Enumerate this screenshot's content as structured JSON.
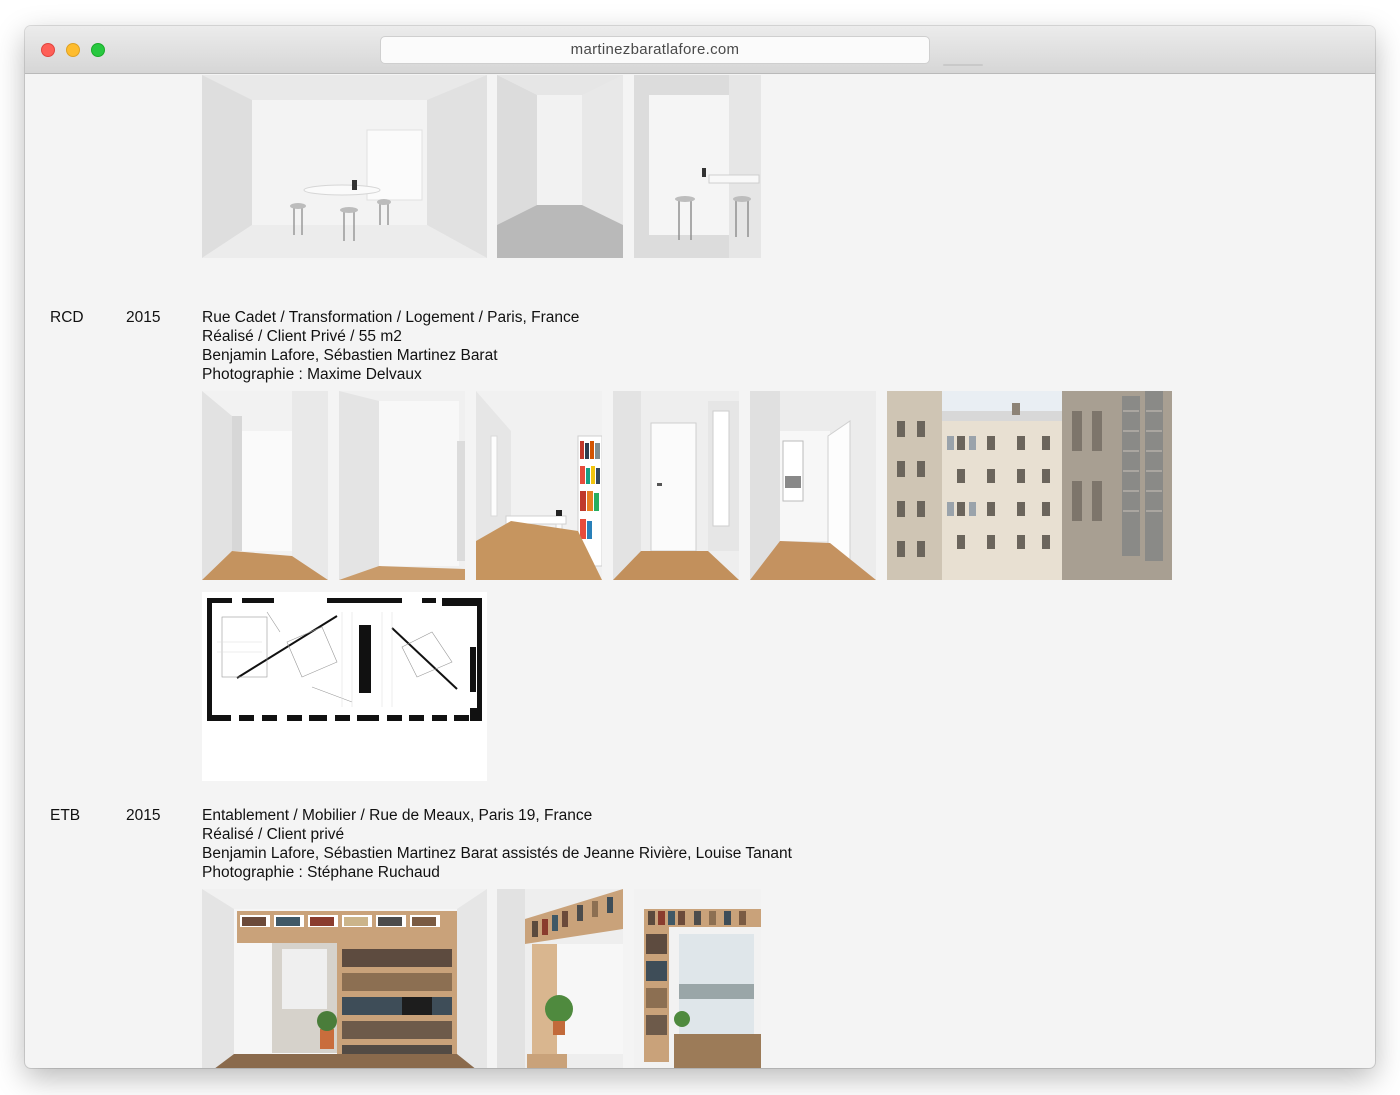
{
  "browser": {
    "url": "martinezbaratlafore.com"
  },
  "projects": [
    {
      "code": "RCD",
      "year": "2015",
      "lines": [
        "Rue Cadet / Transformation / Logement / Paris, France",
        "Réalisé / Client Privé / 55 m2",
        "Benjamin Lafore, Sébastien Martinez Barat",
        "Photographie : Maxime Delvaux"
      ]
    },
    {
      "code": "ETB",
      "year": "2015",
      "lines": [
        "Entablement / Mobilier / Rue de Meaux, Paris 19, France",
        "Réalisé / Client privé",
        "Benjamin Lafore, Sébastien Martinez Barat assistés de Jeanne Rivière, Louise Tanant",
        "Photographie : Stéphane Ruchaud"
      ]
    }
  ]
}
